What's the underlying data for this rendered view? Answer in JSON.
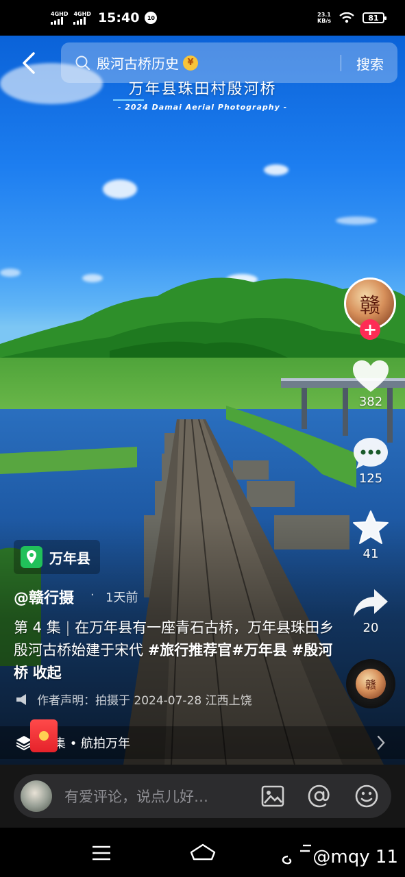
{
  "status_bar": {
    "signal1": "4GHD",
    "signal2": "4GHD",
    "time": "15:40",
    "notif_badge": "10",
    "net_speed_value": "23.1",
    "net_speed_unit": "KB/s",
    "battery": "81"
  },
  "search": {
    "query": "殷河古桥历史",
    "reward_badge": "¥",
    "button": "搜索"
  },
  "video": {
    "title": "万年县珠田村殷河桥",
    "subtitle": "- 2024 Damai Aerial Photography -"
  },
  "creator": {
    "avatar_char": "赣",
    "follow_symbol": "+"
  },
  "actions": {
    "likes": "382",
    "comments": "125",
    "favorites": "41",
    "shares": "20"
  },
  "location": {
    "name": "万年县"
  },
  "post": {
    "author": "@赣行摄",
    "dot": "·",
    "time_ago": "1天前",
    "episode": "第 4 集",
    "separator": "|",
    "text": "在万年县有一座青石古桥，万年县珠田乡殷河古桥始建于宋代",
    "tags": [
      "#旅行推荐官",
      "#万年县",
      "#殷河桥"
    ],
    "collapse": "收起",
    "declaration": "作者声明：拍摄于 2024-07-28 江西上饶"
  },
  "collection": {
    "label": "集 • 航拍万年"
  },
  "comment_bar": {
    "placeholder": "有爱评论，说点儿好…"
  },
  "watermark": "@mqy 11",
  "colors": {
    "accent_red": "#fe2c55",
    "location_green": "#21c05a"
  }
}
